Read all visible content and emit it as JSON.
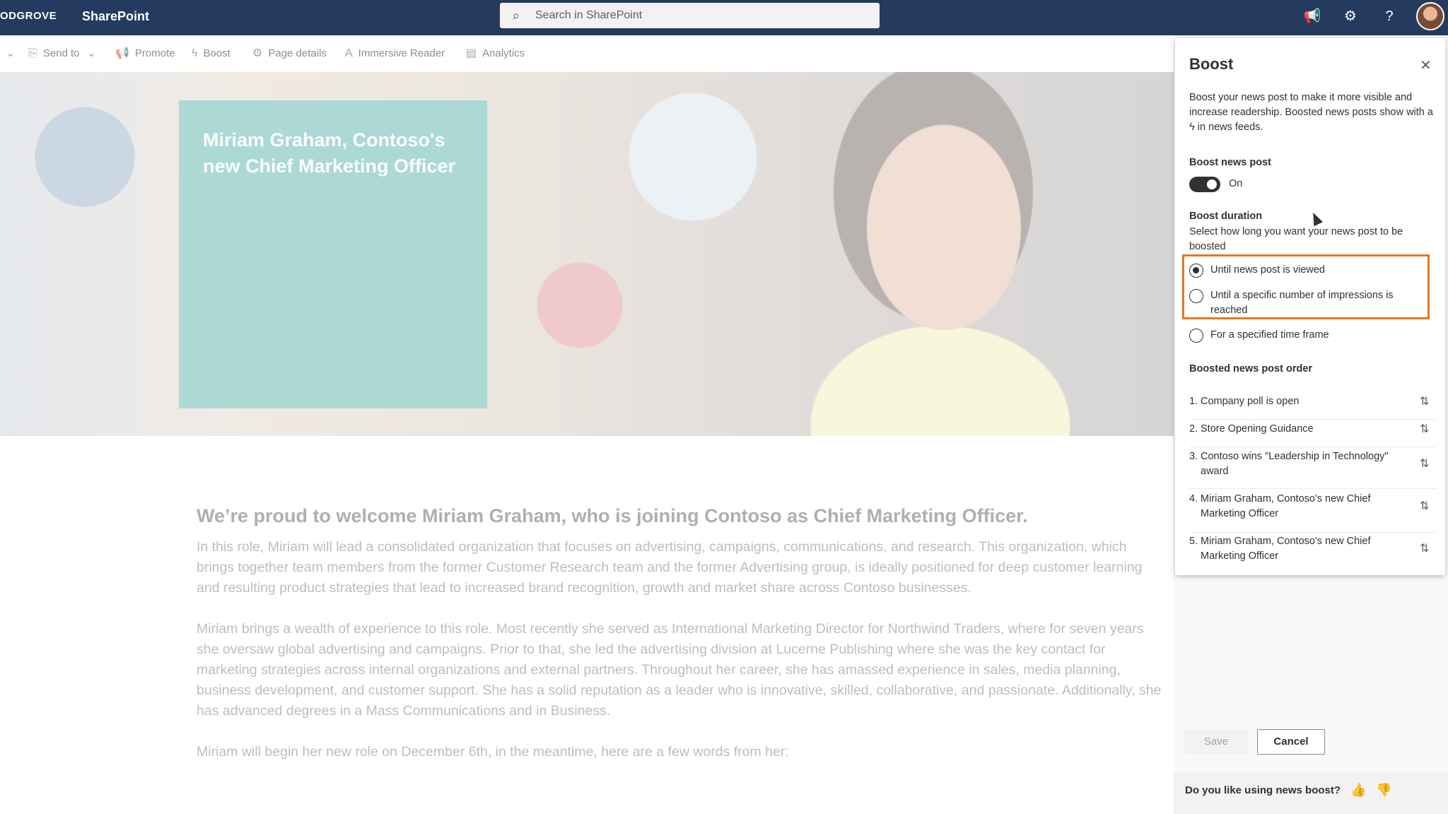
{
  "suite": {
    "brand": "ODGROVE",
    "app": "SharePoint",
    "search_placeholder": "Search in SharePoint"
  },
  "commands": [
    "Send to",
    "Promote",
    "Boost",
    "Page details",
    "Immersive Reader",
    "Analytics"
  ],
  "hero": {
    "title": "Miriam Graham, Contoso's new Chief Marketing Officer"
  },
  "article": {
    "heading": "We’re proud to welcome Miriam Graham, who is joining Contoso as Chief Marketing Officer.",
    "p1": "In this role, Miriam will lead a consolidated organization that focuses on advertising, campaigns, communications, and research. This organization, which brings together team members from the former Customer Research team and the former Advertising group, is ideally positioned for deep customer learning and resulting product strategies that lead to increased brand recognition, growth and market share across Contoso businesses.",
    "p2": "Miriam brings a wealth of experience to this role. Most recently she served as International Marketing Director for Northwind Traders, where for seven years she oversaw global advertising and campaigns. Prior to that, she led the advertising division at Lucerne Publishing where she was the key contact for marketing strategies across internal organizations and external partners.  Throughout her career, she has amassed experience in sales, media planning, business development, and customer support. She has a solid reputation as a leader who is innovative, skilled, collaborative, and passionate. Additionally, she has advanced degrees in a Mass Communications and in Business.",
    "p3": "Miriam will begin her new role on December 6th, in the meantime, here are a few words from her:"
  },
  "panel": {
    "title": "Boost",
    "desc_before": "Boost your news post to make it more visible and increase readership. Boosted news posts show with a ",
    "desc_after": " in news feeds.",
    "boost_label": "Boost news post",
    "toggle_state": "On",
    "duration_label": "Boost duration",
    "duration_desc": "Select how long you want your news post to be boosted",
    "options": [
      "Until news post is viewed",
      "Until a specific number of impressions is reached",
      "For a specified time frame"
    ],
    "selected_option": 0,
    "order_label": "Boosted news post order",
    "order": [
      {
        "num": "1.",
        "text": "Company poll is open"
      },
      {
        "num": "2.",
        "text": "Store Opening Guidance"
      },
      {
        "num": "3.",
        "text": "Contoso wins \"Leadership in Technology\" award"
      },
      {
        "num": "4.",
        "text": "Miriam Graham, Contoso's new Chief Marketing Officer"
      },
      {
        "num": "5.",
        "text": "Miriam Graham, Contoso's new Chief Marketing Officer"
      }
    ],
    "save": "Save",
    "cancel": "Cancel",
    "feedback": "Do you like using news boost?"
  }
}
